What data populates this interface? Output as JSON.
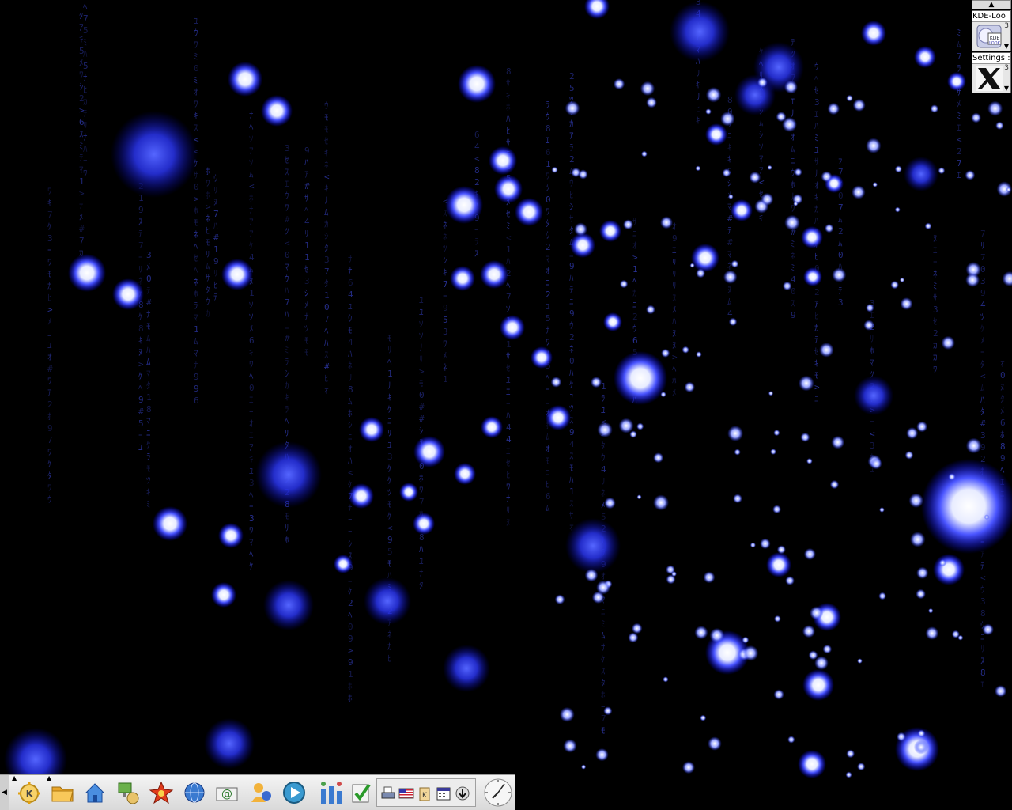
{
  "desktop": {
    "wallpaper": "blue-matrix-bokeh-wallpaper"
  },
  "dock": {
    "scroll_up_icon": "triangle-up-icon",
    "apps": [
      {
        "label": "KDE-Loo",
        "count": "3",
        "icon": "kde-look-icon"
      },
      {
        "label": "Settings :",
        "count": "3",
        "icon": "x-window-icon"
      }
    ]
  },
  "panel": {
    "hide_button_icon": "triangle-left-icon",
    "launchers": [
      {
        "name": "kde-menu-icon",
        "has_menu": true
      },
      {
        "name": "folder-icon",
        "has_menu": true
      },
      {
        "name": "home-icon",
        "has_menu": false
      },
      {
        "name": "network-icon",
        "has_menu": false
      },
      {
        "name": "star-icon",
        "has_menu": false
      },
      {
        "name": "konqueror-icon",
        "has_menu": false
      },
      {
        "name": "mail-icon",
        "has_menu": false
      },
      {
        "name": "messenger-icon",
        "has_menu": false
      },
      {
        "name": "media-player-icon",
        "has_menu": false
      },
      {
        "name": "system-monitor-icon",
        "has_menu": false
      },
      {
        "name": "checklist-icon",
        "has_menu": false
      }
    ],
    "tray": [
      "printer-icon",
      "keyboard-layout-icon",
      "klipper-icon",
      "calendar-icon",
      "download-icon"
    ],
    "clock_icon": "analog-clock-icon"
  },
  "colors": {
    "wallpaper_bg": "#000000",
    "glow_blue": "#2a2aff",
    "glyph_blue": "#2f3a9a",
    "panel_bg": "#e4e4e4"
  }
}
